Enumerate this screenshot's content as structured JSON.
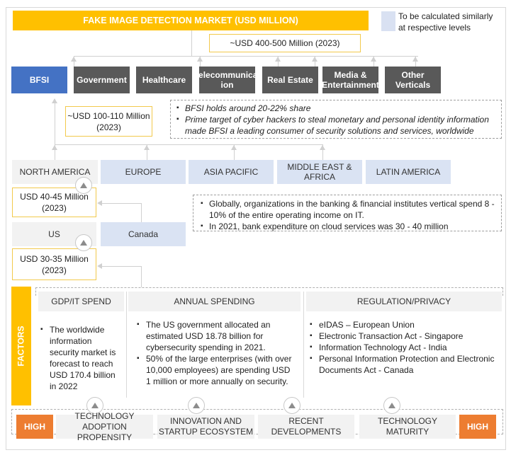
{
  "title": "FAKE IMAGE DETECTION  MARKET (USD MILLION)",
  "legend": {
    "swatch_color": "#d9e1f2",
    "text_line1": "To be calculated similarly",
    "text_line2": "at respective levels"
  },
  "market_size": "~USD 400-500 Million (2023)",
  "verticals": [
    {
      "label": "BFSI",
      "highlighted": true
    },
    {
      "label": "Government",
      "highlighted": false
    },
    {
      "label": "Healthcare",
      "highlighted": false
    },
    {
      "label_line1": "Telecommunicat",
      "label_line2": "ion",
      "highlighted": false
    },
    {
      "label": "Real Estate",
      "highlighted": false
    },
    {
      "label_line1": "Media &",
      "label_line2": "Entertainment",
      "highlighted": false
    },
    {
      "label": "Other Verticals",
      "highlighted": false
    }
  ],
  "bfsi_size": {
    "line1": "~USD 100-110 Million",
    "line2": "(2023)"
  },
  "bfsi_notes": [
    "BFSI holds around 20-22% share",
    "Prime target of cyber hackers to steal monetary and personal identity information made BFSI a leading consumer of security solutions and services, worldwide"
  ],
  "regions": [
    {
      "label": "NORTH AMERICA",
      "highlighted": true
    },
    {
      "label": "EUROPE",
      "highlighted": false
    },
    {
      "label": "ASIA PACIFIC",
      "highlighted": false
    },
    {
      "label_line1": "MIDDLE EAST &",
      "label_line2": "AFRICA",
      "highlighted": false
    },
    {
      "label": "LATIN AMERICA",
      "highlighted": false
    }
  ],
  "na_size": {
    "line1": "USD 40-45 Million",
    "line2": "(2023)"
  },
  "na_notes": [
    "Globally, organizations in the banking & financial institutes vertical spend 8 - 10% of the entire operating income on IT.",
    "In 2021, bank expenditure on cloud services was 30 - 40 million"
  ],
  "countries": [
    {
      "label": "US",
      "highlighted": true
    },
    {
      "label": "Canada",
      "highlighted": false
    }
  ],
  "us_size": {
    "line1": "USD 30-35 Million",
    "line2": "(2023)"
  },
  "factors": {
    "label": "FACTORS",
    "columns": [
      {
        "header": "GDP/IT SPEND",
        "bullets": [
          "The worldwide information security market is forecast to reach USD 170.4 billion in 2022"
        ]
      },
      {
        "header": "ANNUAL SPENDING",
        "bullets": [
          "The US government allocated an estimated USD 18.78 billion for cybersecurity spending in 2021.",
          "50% of the large enterprises (with over 10,000 employees) are spending USD 1 million or more annually on security."
        ]
      },
      {
        "header": "REGULATION/PRIVACY",
        "bullets": [
          "eIDAS – European Union",
          "Electronic Transaction Act - Singapore",
          "Information Technology Act - India",
          "Personal Information Protection and Electronic Documents Act - Canada"
        ]
      }
    ]
  },
  "drivers": {
    "left_badge": "HIGH",
    "right_badge": "HIGH",
    "items": [
      {
        "line1": "TECHNOLOGY ADOPTION",
        "line2": "PROPENSITY"
      },
      {
        "line1": "INNOVATION AND",
        "line2": "STARTUP ECOSYSTEM"
      },
      {
        "line1": "RECENT DEVELOPMENTS",
        "line2": ""
      },
      {
        "line1": "TECHNOLOGY MATURITY",
        "line2": ""
      }
    ]
  },
  "colors": {
    "title_bar": "#ffc000",
    "highlight_blue": "#4472c4",
    "vertical_dark": "#595959",
    "region_light_blue": "#dae3f3",
    "high_badge": "#ed7d31",
    "size_box_border": "#f2c94c"
  }
}
